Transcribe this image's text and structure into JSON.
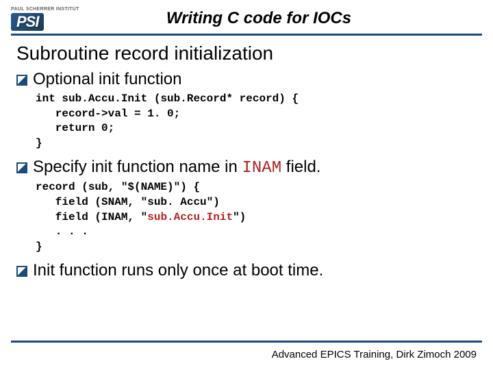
{
  "logo": {
    "topText": "PAUL SCHERRER INSTITUT",
    "main": "PSI"
  },
  "slideTitle": "Writing C code for IOCs",
  "sectionHeading": "Subroutine record initialization",
  "bullets": {
    "b1": "Optional init function",
    "b2_pre": "Specify init function name in ",
    "b2_mono": "INAM",
    "b2_post": " field.",
    "b3": "Init function runs only once at boot time."
  },
  "code1": {
    "l1_pre": "int ",
    "l1_bold": "sub.Accu.Init",
    "l1_post": " (sub.Record* record) {",
    "l2": "   record->val = 1. 0;",
    "l3": "   return 0;",
    "l4": "}"
  },
  "code2": {
    "l1": "record (sub, \"$(NAME)\") {",
    "l2": "   field (SNAM, \"sub. Accu\")",
    "l3_pre": "   field (INAM, \"",
    "l3_red": "sub.Accu.Init",
    "l3_post": "\")",
    "l4": "   . . .",
    "l5": "}"
  },
  "footer": "Advanced EPICS Training, Dirk Zimoch 2009"
}
